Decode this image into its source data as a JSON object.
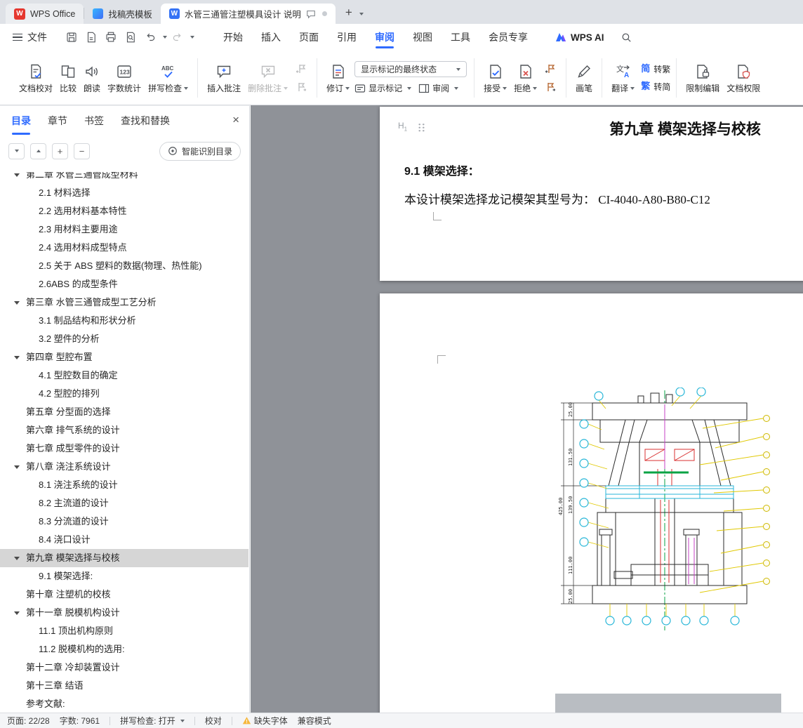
{
  "tabbar": {
    "logo_letter": "W",
    "home": "WPS Office",
    "tab2": "找稿壳模板",
    "tab3": "水管三通管注塑模具设计 说明",
    "doc_icon_letter": "W"
  },
  "menubar": {
    "file": "文件",
    "tabs": [
      {
        "label": "开始"
      },
      {
        "label": "插入"
      },
      {
        "label": "页面"
      },
      {
        "label": "引用"
      },
      {
        "label": "审阅",
        "active": true
      },
      {
        "label": "视图"
      },
      {
        "label": "工具"
      },
      {
        "label": "会员专享"
      }
    ],
    "ai": "WPS AI"
  },
  "ribbon": {
    "doc_proof": "文档校对",
    "compare": "比较",
    "read_aloud": "朗读",
    "word_count": "字数统计",
    "count_icon_text": "123",
    "spell_check": "拼写检查",
    "abc_icon_text": "ABC",
    "insert_comment": "插入批注",
    "delete_comment": "删除批注",
    "track_changes": "修订",
    "markup_state": "显示标记的最终状态",
    "show_markup": "显示标记",
    "review_pane": "审阅",
    "accept": "接受",
    "reject": "拒绝",
    "pen": "画笔",
    "translate": "翻译",
    "translate_zh": "文",
    "translate_en": "A",
    "simp_char": "简",
    "trad_char": "繁",
    "to_trad": "转繁",
    "to_simp": "转简",
    "restrict_edit": "限制编辑",
    "doc_permission": "文档权限"
  },
  "sidebar": {
    "tabs": [
      {
        "label": "目录",
        "active": true
      },
      {
        "label": "章节"
      },
      {
        "label": "书签"
      },
      {
        "label": "查找和替换"
      }
    ],
    "smart_toc": "智能识别目录",
    "toc": [
      {
        "label": "第二章 水管三通管成型材料",
        "tri": true,
        "cut": true
      },
      {
        "label": "2.1 材料选择",
        "lv2": true
      },
      {
        "label": "2.2 选用材料基本特性",
        "lv2": true
      },
      {
        "label": "2.3 用材料主要用途",
        "lv2": true
      },
      {
        "label": "2.4 选用材料成型特点",
        "lv2": true
      },
      {
        "label": "2.5 关于 ABS 塑料的数据(物理、热性能)",
        "lv2": true
      },
      {
        "label": "2.6ABS 的成型条件",
        "lv2": true
      },
      {
        "label": "第三章 水管三通管成型工艺分析",
        "tri": true
      },
      {
        "label": "3.1 制品结构和形状分析",
        "lv2": true
      },
      {
        "label": "3.2 塑件的分析",
        "lv2": true
      },
      {
        "label": "第四章 型腔布置",
        "tri": true
      },
      {
        "label": "4.1 型腔数目的确定",
        "lv2": true
      },
      {
        "label": "4.2 型腔的排列",
        "lv2": true
      },
      {
        "label": "第五章 分型面的选择"
      },
      {
        "label": "第六章 排气系统的设计"
      },
      {
        "label": "第七章 成型零件的设计"
      },
      {
        "label": "第八章 浇注系统设计",
        "tri": true
      },
      {
        "label": "8.1 浇注系统的设计",
        "lv2": true
      },
      {
        "label": "8.2 主流道的设计",
        "lv2": true
      },
      {
        "label": "8.3 分流道的设计",
        "lv2": true
      },
      {
        "label": "8.4 浇口设计",
        "lv2": true
      },
      {
        "label": "第九章 模架选择与校核",
        "tri": true,
        "sel": true
      },
      {
        "label": "9.1 模架选择:",
        "lv2": true
      },
      {
        "label": "第十章 注塑机的校核"
      },
      {
        "label": "第十一章 脱模机构设计",
        "tri": true
      },
      {
        "label": "11.1 顶出机构原则",
        "lv2": true
      },
      {
        "label": "11.2 脱模机构的选用:",
        "lv2": true
      },
      {
        "label": "第十二章 冷却装置设计"
      },
      {
        "label": "第十三章 结语"
      },
      {
        "label": "参考文献:"
      }
    ]
  },
  "document": {
    "title": "第九章 模架选择与校核",
    "heading": "9.1 模架选择：",
    "body": "本设计模架选择龙记模架其型号为： CI-4040-A80-B80-C12",
    "drawing": {
      "dims": [
        "25.00",
        "131.50",
        "425.00",
        "139.50",
        "111.00",
        "25.00"
      ]
    }
  },
  "statusbar": {
    "page": "页面: 22/28",
    "words": "字数: 7961",
    "spell": "拼写检查: 打开",
    "proof": "校对",
    "missing_font": "缺失字体",
    "compat": "兼容模式"
  }
}
